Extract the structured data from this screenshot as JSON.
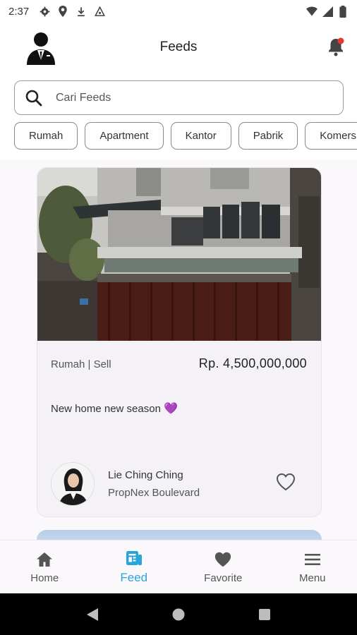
{
  "status_bar": {
    "time": "2:37",
    "left_icons": [
      "settings-icon",
      "location-icon",
      "download-icon",
      "vpn-icon"
    ],
    "right_icons": [
      "wifi-icon",
      "signal-icon",
      "battery-icon"
    ]
  },
  "app_bar": {
    "title": "Feeds",
    "logo_icon": "businessman-avatar-icon",
    "notification_icon": "bell-icon",
    "notification_badge_color": "#e53935"
  },
  "search": {
    "placeholder": "Cari Feeds",
    "value": ""
  },
  "categories": [
    "Rumah",
    "Apartment",
    "Kantor",
    "Pabrik",
    "Komersial"
  ],
  "feed": [
    {
      "type_label": "Rumah | Sell",
      "price": "Rp. 4,500,000,000",
      "caption": "New home new season",
      "caption_emoji": "💜",
      "agent_name": "Lie Ching Ching",
      "agent_office": "PropNex Boulevard",
      "favorite_icon": "heart-outline-icon"
    }
  ],
  "bottom_nav": [
    {
      "label": "Home",
      "icon": "home-icon",
      "active": false
    },
    {
      "label": "Feed",
      "icon": "feed-icon",
      "active": true
    },
    {
      "label": "Favorite",
      "icon": "heart-icon",
      "active": false
    },
    {
      "label": "Menu",
      "icon": "menu-icon",
      "active": false
    }
  ],
  "colors": {
    "accent": "#29a6d9",
    "feed_background": "#fbf8fc",
    "card_background": "#f5f2f7"
  }
}
